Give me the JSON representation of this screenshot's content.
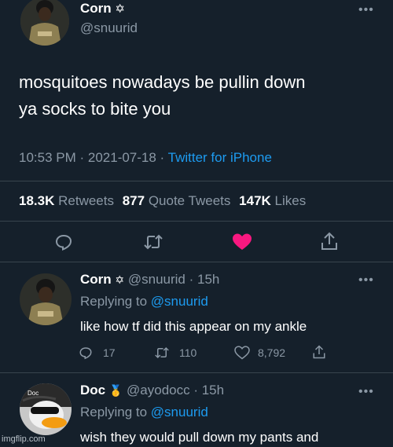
{
  "main_tweet": {
    "author_name": "Corn",
    "author_badge": "✡",
    "handle": "@snuurid",
    "text_line1": "mosquitoes nowadays be pullin down",
    "text_line2": "ya socks to bite you",
    "time": "10:53 PM · 2021-07-18 · ",
    "source": "Twitter for iPhone",
    "retweets_count": "18.3K",
    "retweets_label": "Retweets",
    "quotes_count": "877",
    "quotes_label": "Quote Tweets",
    "likes_count": "147K",
    "likes_label": "Likes",
    "more": "•••"
  },
  "reply1": {
    "author_name": "Corn",
    "author_badge": "✡",
    "handle_time": "@snuurid · 15h",
    "replying_prefix": "Replying to ",
    "replying_handle": "@snuurid",
    "text": "like how tf did this appear on my ankle",
    "reply_count": "17",
    "retweet_count": "110",
    "like_count": "8,792",
    "more": "•••"
  },
  "reply2": {
    "author_name": "Doc",
    "author_badge": "🥇",
    "handle_time": "@ayodocc · 15h",
    "replying_prefix": "Replying to ",
    "replying_handle": "@snuurid",
    "text": "wish they would pull down my pants and",
    "avatar_text": "Doc",
    "more": "•••"
  },
  "watermark": "imgflip.com",
  "colors": {
    "background": "#15202b",
    "link": "#1d9bf0",
    "like": "#f91880",
    "secondary": "#8b98a5",
    "divider": "#38444d"
  }
}
